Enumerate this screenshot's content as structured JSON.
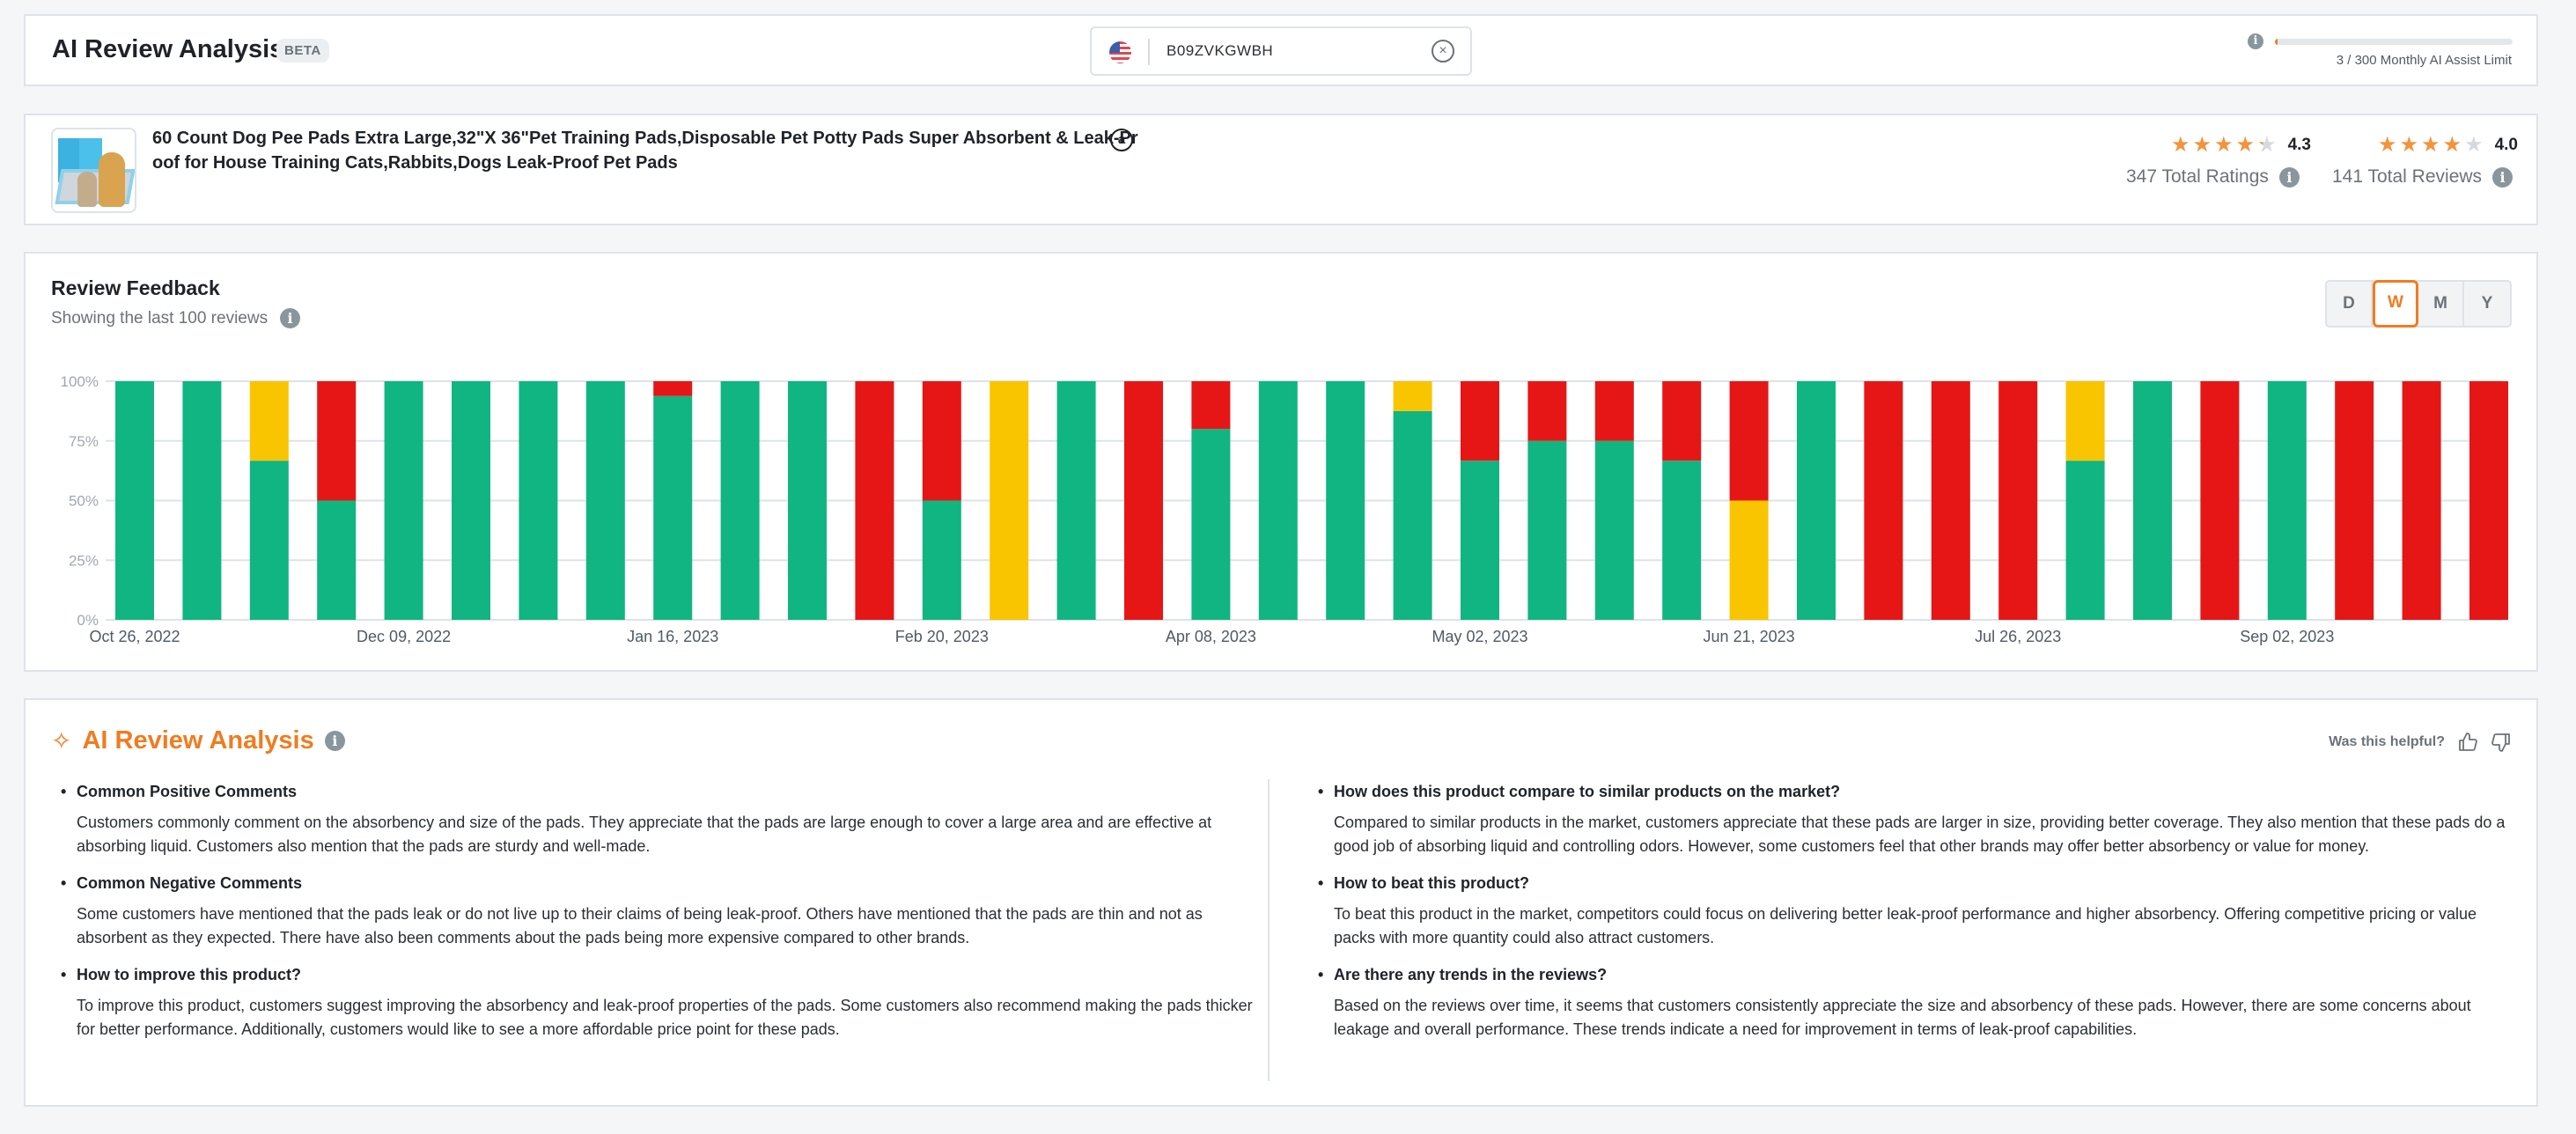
{
  "header": {
    "title": "AI Review Analysis",
    "badge": "BETA",
    "search": {
      "country_icon": "us-flag-icon",
      "value": "B09ZVKGWBH"
    },
    "limit": {
      "used": 3,
      "total": 300,
      "text": "3 / 300 Monthly AI Assist Limit",
      "fill_fraction": 0.01
    }
  },
  "product": {
    "title": "60 Count Dog Pee Pads Extra Large,32\"X 36\"Pet Training Pads,Disposable Pet Potty Pads Super Absorbent & Leak-Proof for House Training Cats,Rabbits,Dogs Leak-Proof Pet Pads",
    "marketplace_icon": "a",
    "ratings": {
      "stars": 4.3,
      "value": "4.3",
      "count_text": "347 Total Ratings"
    },
    "reviews": {
      "stars": 4.0,
      "value": "4.0",
      "count_text": "141 Total Reviews"
    }
  },
  "review_feedback": {
    "title": "Review Feedback",
    "subtitle": "Showing the last 100 reviews",
    "periods": [
      "D",
      "W",
      "M",
      "Y"
    ],
    "active_period": "W"
  },
  "chart_data": {
    "type": "bar",
    "stacked": true,
    "title": "Review Feedback",
    "xlabel": "",
    "ylabel": "",
    "ylim": [
      0,
      100
    ],
    "y_ticks": [
      "0%",
      "25%",
      "50%",
      "75%",
      "100%"
    ],
    "x_tick_labels": [
      "Oct 26, 2022",
      "Dec 09, 2022",
      "Jan 16, 2023",
      "Feb 20, 2023",
      "Apr 08, 2023",
      "May 02, 2023",
      "Jun 21, 2023",
      "Jul 26, 2023",
      "Sep 02, 2023"
    ],
    "x_tick_label_bar_index": [
      0,
      4,
      8,
      12,
      16,
      20,
      24,
      28,
      32
    ],
    "grid": true,
    "colors": {
      "positive": "#10b582",
      "neutral": "#f8c500",
      "negative": "#e61616"
    },
    "series": [
      {
        "name": "positive",
        "values": [
          100,
          100,
          66.7,
          50,
          100,
          100,
          100,
          100,
          93.8,
          100,
          100,
          0,
          50,
          0,
          100,
          0,
          80,
          100,
          100,
          87.5,
          66.7,
          75,
          75,
          66.7,
          0,
          100,
          0,
          0,
          0,
          66.7,
          100,
          0,
          100,
          0,
          0,
          0
        ]
      },
      {
        "name": "neutral",
        "values": [
          0,
          0,
          33.3,
          0,
          0,
          0,
          0,
          0,
          0,
          0,
          0,
          0,
          0,
          100,
          0,
          0,
          0,
          0,
          0,
          12.5,
          0,
          0,
          0,
          0,
          50,
          0,
          0,
          0,
          0,
          33.3,
          0,
          0,
          0,
          0,
          0,
          0
        ]
      },
      {
        "name": "negative",
        "values": [
          0,
          0,
          0,
          50,
          0,
          0,
          0,
          0,
          6.2,
          0,
          0,
          100,
          50,
          0,
          0,
          100,
          20,
          0,
          0,
          0,
          33.3,
          25,
          25,
          33.3,
          50,
          0,
          100,
          100,
          100,
          0,
          0,
          100,
          0,
          100,
          100,
          100
        ]
      }
    ]
  },
  "ai_analysis": {
    "title": "AI Review Analysis",
    "helpful_label": "Was this helpful?",
    "left": [
      {
        "q": "Common Positive Comments",
        "a": "Customers commonly comment on the absorbency and size of the pads. They appreciate that the pads are large enough to cover a large area and are effective at absorbing liquid. Customers also mention that the pads are sturdy and well-made."
      },
      {
        "q": "Common Negative Comments",
        "a": "Some customers have mentioned that the pads leak or do not live up to their claims of being leak-proof. Others have mentioned that the pads are thin and not as absorbent as they expected. There have also been comments about the pads being more expensive compared to other brands."
      },
      {
        "q": "How to improve this product?",
        "a": "To improve this product, customers suggest improving the absorbency and leak-proof properties of the pads. Some customers also recommend making the pads thicker for better performance. Additionally, customers would like to see a more affordable price point for these pads."
      }
    ],
    "right": [
      {
        "q": "How does this product compare to similar products on the market?",
        "a": "Compared to similar products in the market, customers appreciate that these pads are larger in size, providing better coverage. They also mention that these pads do a good job of absorbing liquid and controlling odors. However, some customers feel that other brands may offer better absorbency or value for money."
      },
      {
        "q": "How to beat this product?",
        "a": "To beat this product in the market, competitors could focus on delivering better leak-proof performance and higher absorbency. Offering competitive pricing or value packs with more quantity could also attract customers."
      },
      {
        "q": "Are there any trends in the reviews?",
        "a": "Based on the reviews over time, it seems that customers consistently appreciate the size and absorbency of these pads. However, there are some concerns about leakage and overall performance. These trends indicate a need for improvement in terms of leak-proof capabilities."
      }
    ]
  }
}
